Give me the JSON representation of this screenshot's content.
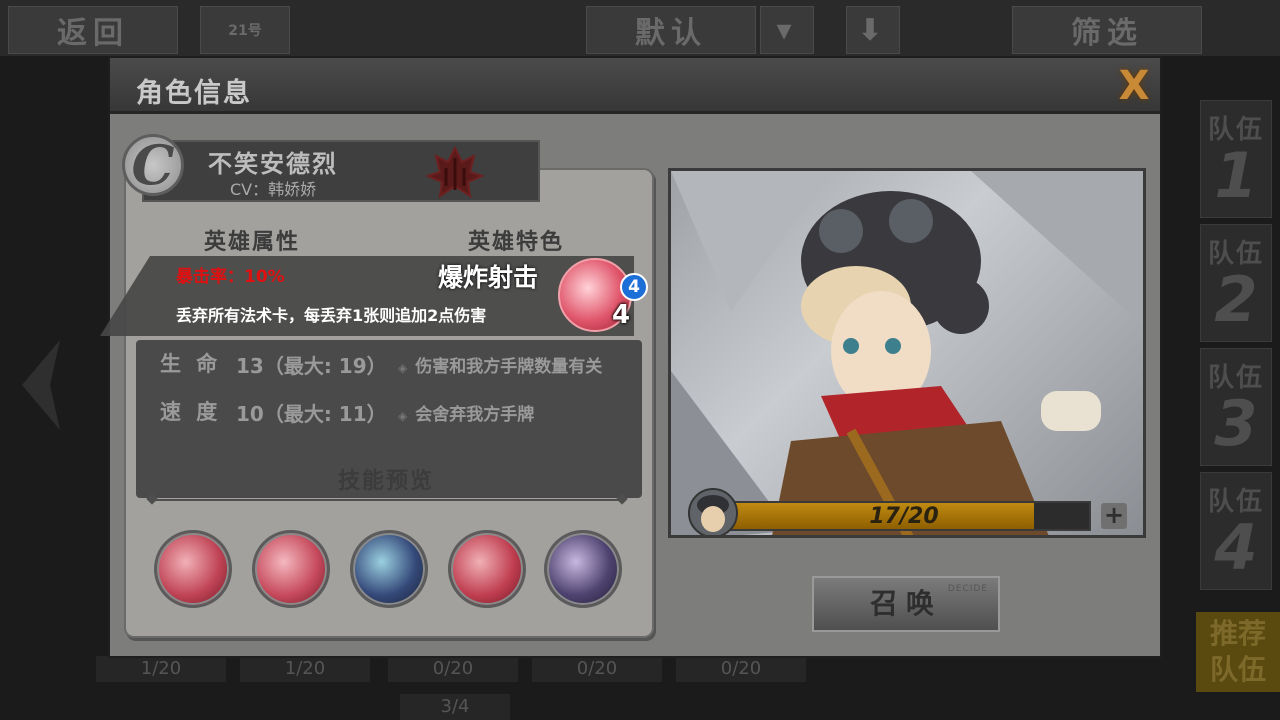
{
  "background": {
    "back_label": "返回",
    "tab_number": "21号",
    "default_label": "默认",
    "filter_label": "筛选",
    "team_label": "队伍",
    "teams": [
      "1",
      "2",
      "3",
      "4"
    ],
    "recommend_label_1": "推荐",
    "recommend_label_2": "队伍",
    "slot_counts": [
      "1/20",
      "1/20",
      "0/20",
      "0/20",
      "0/20"
    ],
    "page": "3/4"
  },
  "modal": {
    "title": "角色信息",
    "close": "X"
  },
  "hero": {
    "rank": "C",
    "name": "不笑安德烈",
    "cv": "CV：韩娇娇",
    "attributes_title": "英雄属性",
    "features_title": "英雄特色",
    "stats": {
      "hp_label": "生 命",
      "hp_value": "13（最大: 19）",
      "speed_label": "速 度",
      "speed_value": "10（最大: 11）"
    },
    "features": [
      "伤害和我方手牌数量有关",
      "会舍弃我方手牌"
    ],
    "skills_title": "技能预览",
    "hp_current": 17,
    "hp_max": 20,
    "hp_text": "17/20"
  },
  "tooltip": {
    "crit": "暴击率：10%",
    "skill_name": "爆炸射击",
    "description": "丢弃所有法术卡，每丢弃1张则追加2点伤害",
    "cost": "4",
    "cooldown": "4"
  },
  "summon": {
    "label": "召唤",
    "sub": "DECIDE"
  },
  "colors": {
    "crit_red": "#e01010",
    "cost_blue": "#1d6fd8",
    "hp_orange": "#c08a12",
    "close_orange": "#c98a38"
  }
}
